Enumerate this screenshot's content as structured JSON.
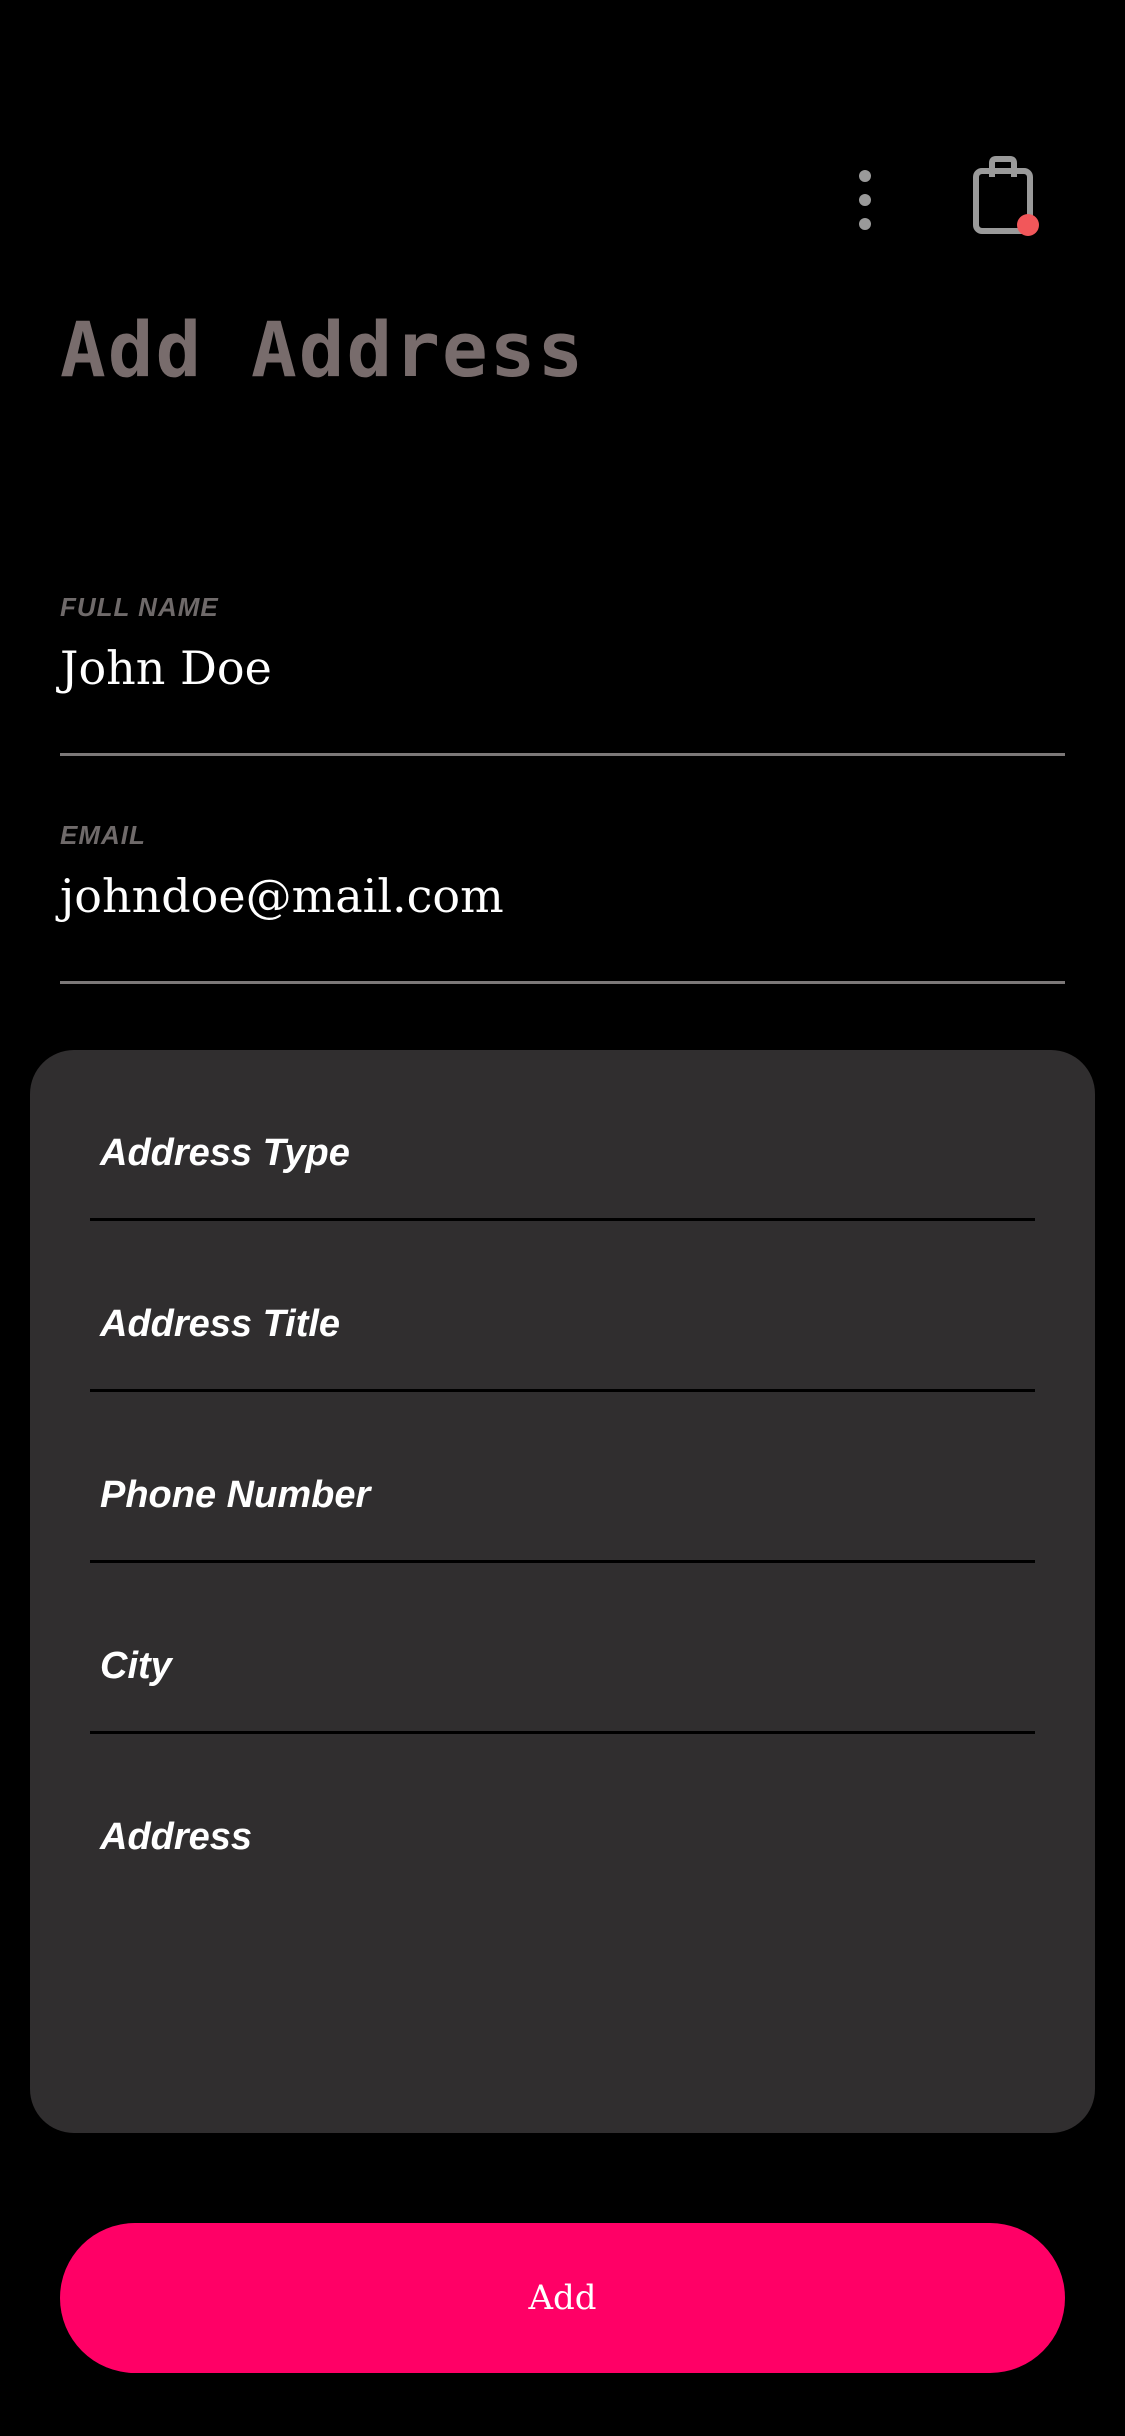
{
  "header": {
    "menu_icon": "more-vertical-icon",
    "cart_icon": "shopping-bag-icon",
    "cart_badge_color": "#f2575a"
  },
  "page": {
    "title": "Add Address"
  },
  "fields": {
    "full_name": {
      "label": "FULL NAME",
      "value": "John Doe"
    },
    "email": {
      "label": "EMAIL",
      "value": "johndoe@mail.com"
    }
  },
  "address_form": {
    "rows": [
      {
        "label": "Address Type"
      },
      {
        "label": "Address Title"
      },
      {
        "label": "Phone Number"
      },
      {
        "label": "City"
      },
      {
        "label": "Address"
      }
    ]
  },
  "actions": {
    "add_label": "Add"
  },
  "colors": {
    "background": "#000000",
    "title": "#786c6c",
    "card": "#302e2f",
    "accent": "#ff0066"
  }
}
